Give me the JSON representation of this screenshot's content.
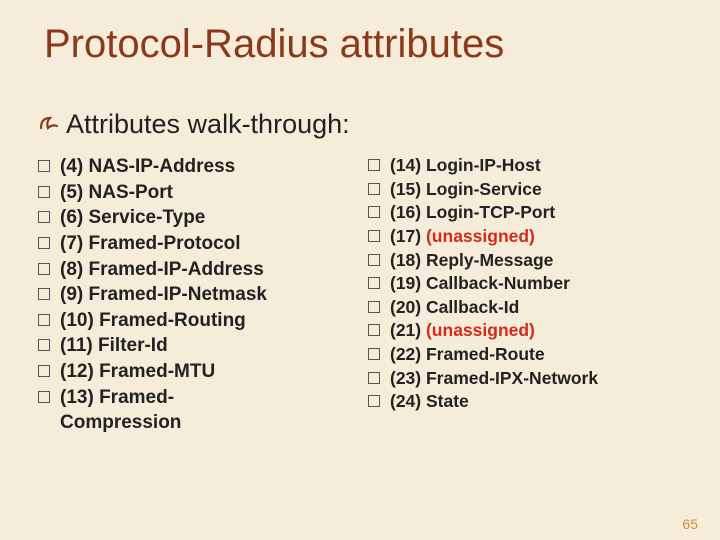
{
  "title": "Protocol-Radius attributes",
  "subtitle": "Attributes  walk-through:",
  "left_items": [
    {
      "num": "(4)",
      "label": "NAS-IP-Address",
      "red": false
    },
    {
      "num": "(5)",
      "label": "NAS-Port",
      "red": false
    },
    {
      "num": "(6)",
      "label": "Service-Type",
      "red": false
    },
    {
      "num": "(7)",
      "label": "Framed-Protocol",
      "red": false
    },
    {
      "num": "(8)",
      "label": "Framed-IP-Address",
      "red": false
    },
    {
      "num": "(9)",
      "label": "Framed-IP-Netmask",
      "red": false
    },
    {
      "num": "(10)",
      "label": "Framed-Routing",
      "red": false
    },
    {
      "num": "(11)",
      "label": "Filter-Id",
      "red": false
    },
    {
      "num": "(12)",
      "label": "Framed-MTU",
      "red": false
    },
    {
      "num": "(13)",
      "label": "Framed-\nCompression",
      "red": false
    }
  ],
  "right_items": [
    {
      "num": "(14)",
      "label": "Login-IP-Host",
      "red": false
    },
    {
      "num": "(15)",
      "label": "Login-Service",
      "red": false
    },
    {
      "num": "(16)",
      "label": "Login-TCP-Port",
      "red": false
    },
    {
      "num": "(17)",
      "label": "(unassigned)",
      "red": true
    },
    {
      "num": "(18)",
      "label": "Reply-Message",
      "red": false
    },
    {
      "num": "(19)",
      "label": "Callback-Number",
      "red": false
    },
    {
      "num": "(20)",
      "label": "Callback-Id",
      "red": false
    },
    {
      "num": "(21)",
      "label": "(unassigned)",
      "red": true
    },
    {
      "num": "(22)",
      "label": "Framed-Route",
      "red": false
    },
    {
      "num": "(23)",
      "label": "Framed-IPX-Network",
      "red": false
    },
    {
      "num": "(24)",
      "label": "State",
      "red": false
    }
  ],
  "page_number": "65",
  "colors": {
    "title": "#8a3a1a",
    "unassigned": "#d42a1a",
    "background": "#f5edd9",
    "page_num": "#c5952d"
  }
}
